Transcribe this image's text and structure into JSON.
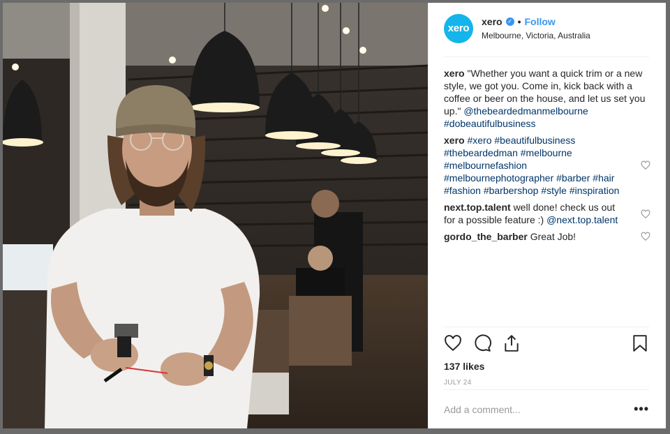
{
  "post": {
    "username": "xero",
    "avatar_text": "xero",
    "avatar_color": "#13b5ea",
    "follow_label": "Follow",
    "separator": "•",
    "location": "Melbourne, Victoria, Australia",
    "verified": true
  },
  "comments": [
    {
      "author": "xero",
      "text": "\"Whether you want a quick trim or a new style, we got you. Come in, kick back with a coffee or beer on the house, and let us set you up.\"",
      "links": [
        "@thebeardedmanmelbourne",
        "#dobeautifulbusiness"
      ],
      "likeable": false
    },
    {
      "author": "xero",
      "links": [
        "#xero",
        "#beautifulbusiness",
        "#thebeardedman",
        "#melbourne",
        "#melbournefashion",
        "#melbournephotographer",
        "#barber",
        "#hair",
        "#fashion",
        "#barbershop",
        "#style",
        "#inspiration"
      ],
      "likeable": true
    },
    {
      "author": "next.top.talent",
      "text": "well done! check us out for a possible feature :)",
      "links": [
        "@next.top.talent"
      ],
      "likeable": true
    },
    {
      "author": "gordo_the_barber",
      "text": "Great Job!",
      "likeable": true
    }
  ],
  "engagement": {
    "likes": "137 likes",
    "date": "JULY 24"
  },
  "add_comment": {
    "placeholder": "Add a comment...",
    "more": "•••"
  },
  "icons": {
    "like": "heart-icon",
    "comment": "comment-bubble-icon",
    "share": "share-icon",
    "save": "bookmark-icon",
    "comment_like": "heart-outline-icon"
  },
  "colors": {
    "link": "#003569",
    "follow": "#3897f0",
    "muted": "#999999"
  }
}
